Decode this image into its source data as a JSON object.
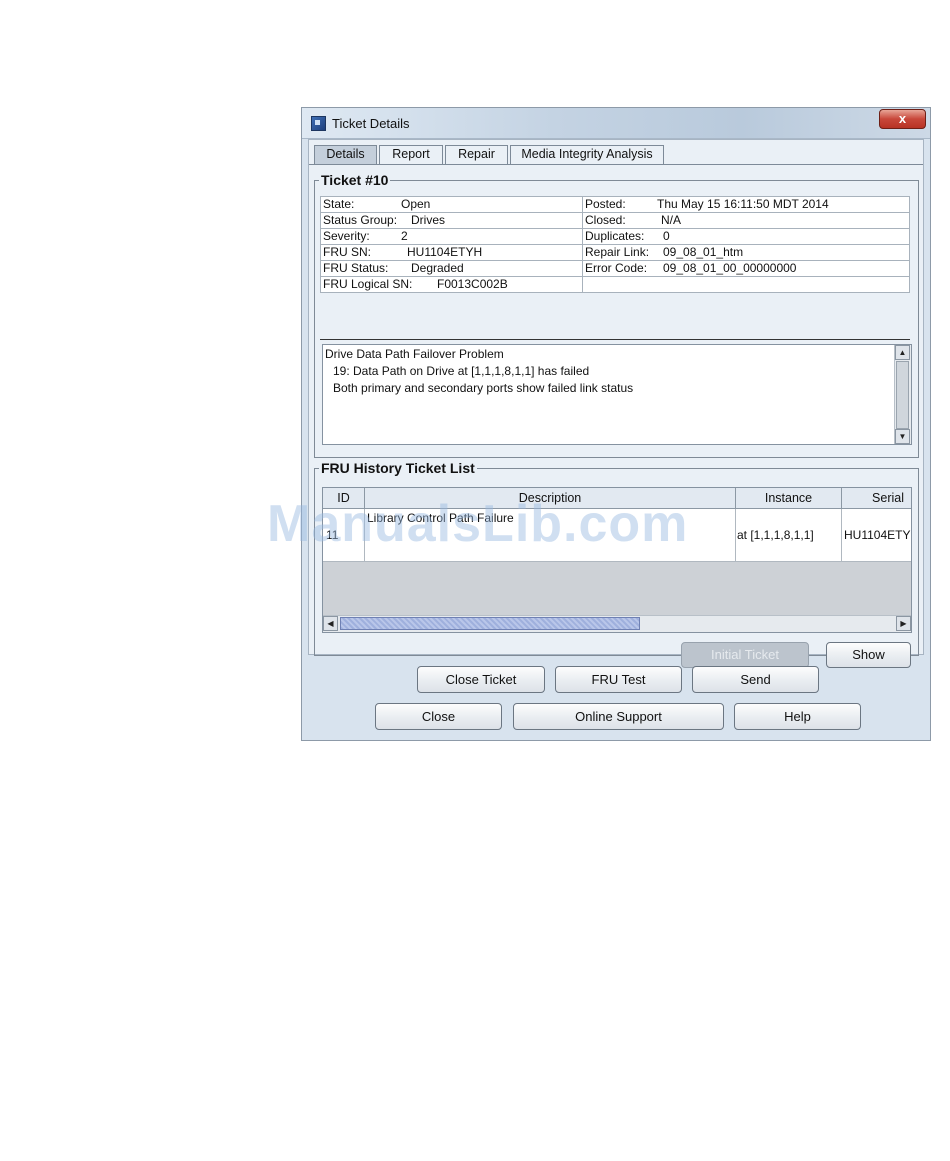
{
  "window": {
    "title": "Ticket Details",
    "close_glyph": "x"
  },
  "tabs": [
    {
      "label": "Details",
      "active": true
    },
    {
      "label": "Report",
      "active": false
    },
    {
      "label": "Repair",
      "active": false
    },
    {
      "label": "Media Integrity Analysis",
      "active": false
    }
  ],
  "ticket": {
    "group_title": "Ticket #10",
    "left_rows": [
      {
        "label": "State:",
        "value": "Open"
      },
      {
        "label": "Status Group:",
        "value": "Drives"
      },
      {
        "label": "Severity:",
        "value": "2"
      },
      {
        "label": "FRU SN:",
        "value": "HU1104ETYH"
      },
      {
        "label": "FRU Status:",
        "value": "Degraded"
      },
      {
        "label": "FRU Logical SN:",
        "value": "F0013C002B"
      }
    ],
    "right_rows": [
      {
        "label": "Posted:",
        "value": "Thu May 15 16:11:50 MDT 2014"
      },
      {
        "label": "Closed:",
        "value": "N/A"
      },
      {
        "label": "Duplicates:",
        "value": "0"
      },
      {
        "label": "Repair Link:",
        "value": "09_08_01_htm"
      },
      {
        "label": "Error Code:",
        "value": "09_08_01_00_00000000"
      },
      {
        "label": "",
        "value": ""
      }
    ],
    "message_lines": [
      "Drive Data Path Failover Problem",
      "19: Data Path on Drive at [1,1,1,8,1,1] has failed",
      "Both primary and secondary ports show failed link status"
    ]
  },
  "fru_history": {
    "group_title": "FRU History Ticket List",
    "columns": [
      "ID",
      "Description",
      "Instance",
      "Serial"
    ],
    "rows": [
      {
        "id": "11",
        "description": "Library Control Path Failure",
        "instance": "at [1,1,1,8,1,1]",
        "serial": "HU1104ETY"
      }
    ],
    "initial_ticket_label": "Initial Ticket",
    "show_label": "Show"
  },
  "bottom_buttons": {
    "close_ticket": "Close Ticket",
    "fru_test": "FRU Test",
    "send": "Send",
    "close": "Close",
    "online_support": "Online Support",
    "help": "Help"
  },
  "watermark": "ManualsLib.com",
  "colors": {
    "window_bg": "#d8e3ee",
    "client_bg": "#eaf0f6",
    "scroll_thumb": "#9fb0dd",
    "close_button": "#c8473a"
  }
}
